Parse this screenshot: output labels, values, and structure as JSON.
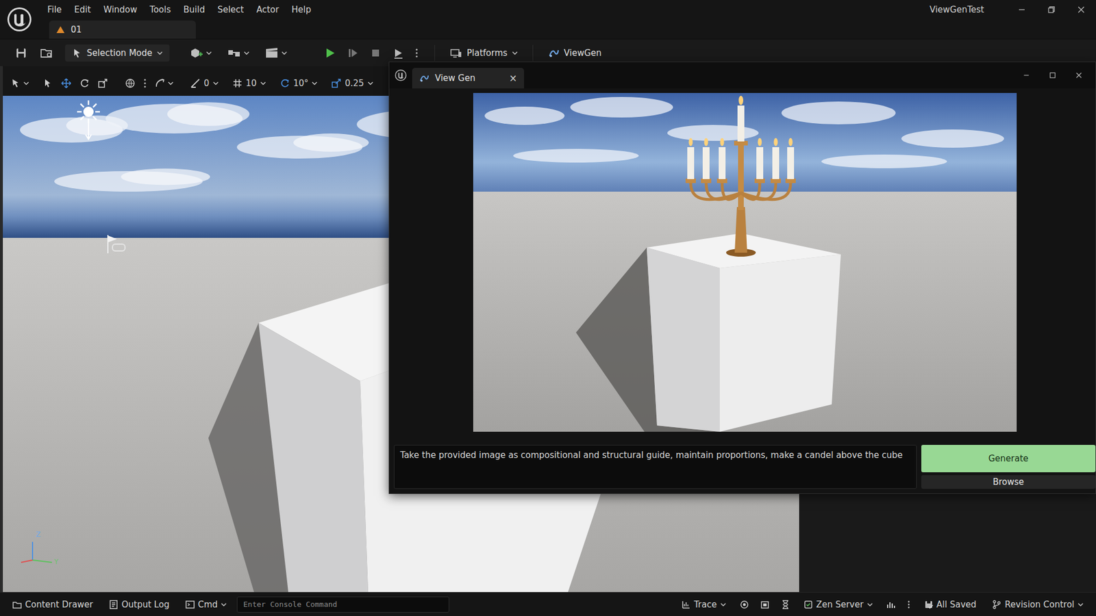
{
  "app": {
    "title": "ViewGenTest",
    "level_tab": "01"
  },
  "menu": [
    "File",
    "Edit",
    "Window",
    "Tools",
    "Build",
    "Select",
    "Actor",
    "Help"
  ],
  "toolbar": {
    "mode": "Selection Mode",
    "platforms": "Platforms",
    "plugin": "ViewGen"
  },
  "viewport_toolbar": {
    "snaps": [
      {
        "kind": "surface",
        "value": "0"
      },
      {
        "kind": "grid",
        "value": "10"
      },
      {
        "kind": "rotate",
        "value": "10°"
      },
      {
        "kind": "scale",
        "value": "0.25"
      }
    ]
  },
  "viewport": {
    "axes": [
      "Z",
      "Y"
    ]
  },
  "view_gen": {
    "title": "View Gen",
    "close": "×",
    "prompt": "Take the provided image as compositional and structural guide, maintain proportions, make a candel above the cube",
    "buttons": [
      {
        "label": "Generate",
        "hovered": true,
        "primary": true
      },
      {
        "label": "Browse",
        "hovered": false,
        "primary": false
      }
    ]
  },
  "status_bar": {
    "left": [
      {
        "label": "Content Drawer",
        "kind": "drawer",
        "dropdown": false
      },
      {
        "label": "Output Log",
        "kind": "log",
        "dropdown": false
      },
      {
        "label": "Cmd",
        "kind": "cmd",
        "dropdown": true
      }
    ],
    "console_placeholder": "Enter Console Command",
    "right": [
      {
        "label": "Trace",
        "kind": "trace",
        "dropdown": true
      },
      {
        "label": "Zen Server",
        "kind": "zen",
        "dropdown": true
      },
      {
        "label": "All Saved",
        "kind": "saved",
        "dropdown": false
      },
      {
        "label": "Revision Control",
        "kind": "revision",
        "dropdown": true
      }
    ]
  }
}
